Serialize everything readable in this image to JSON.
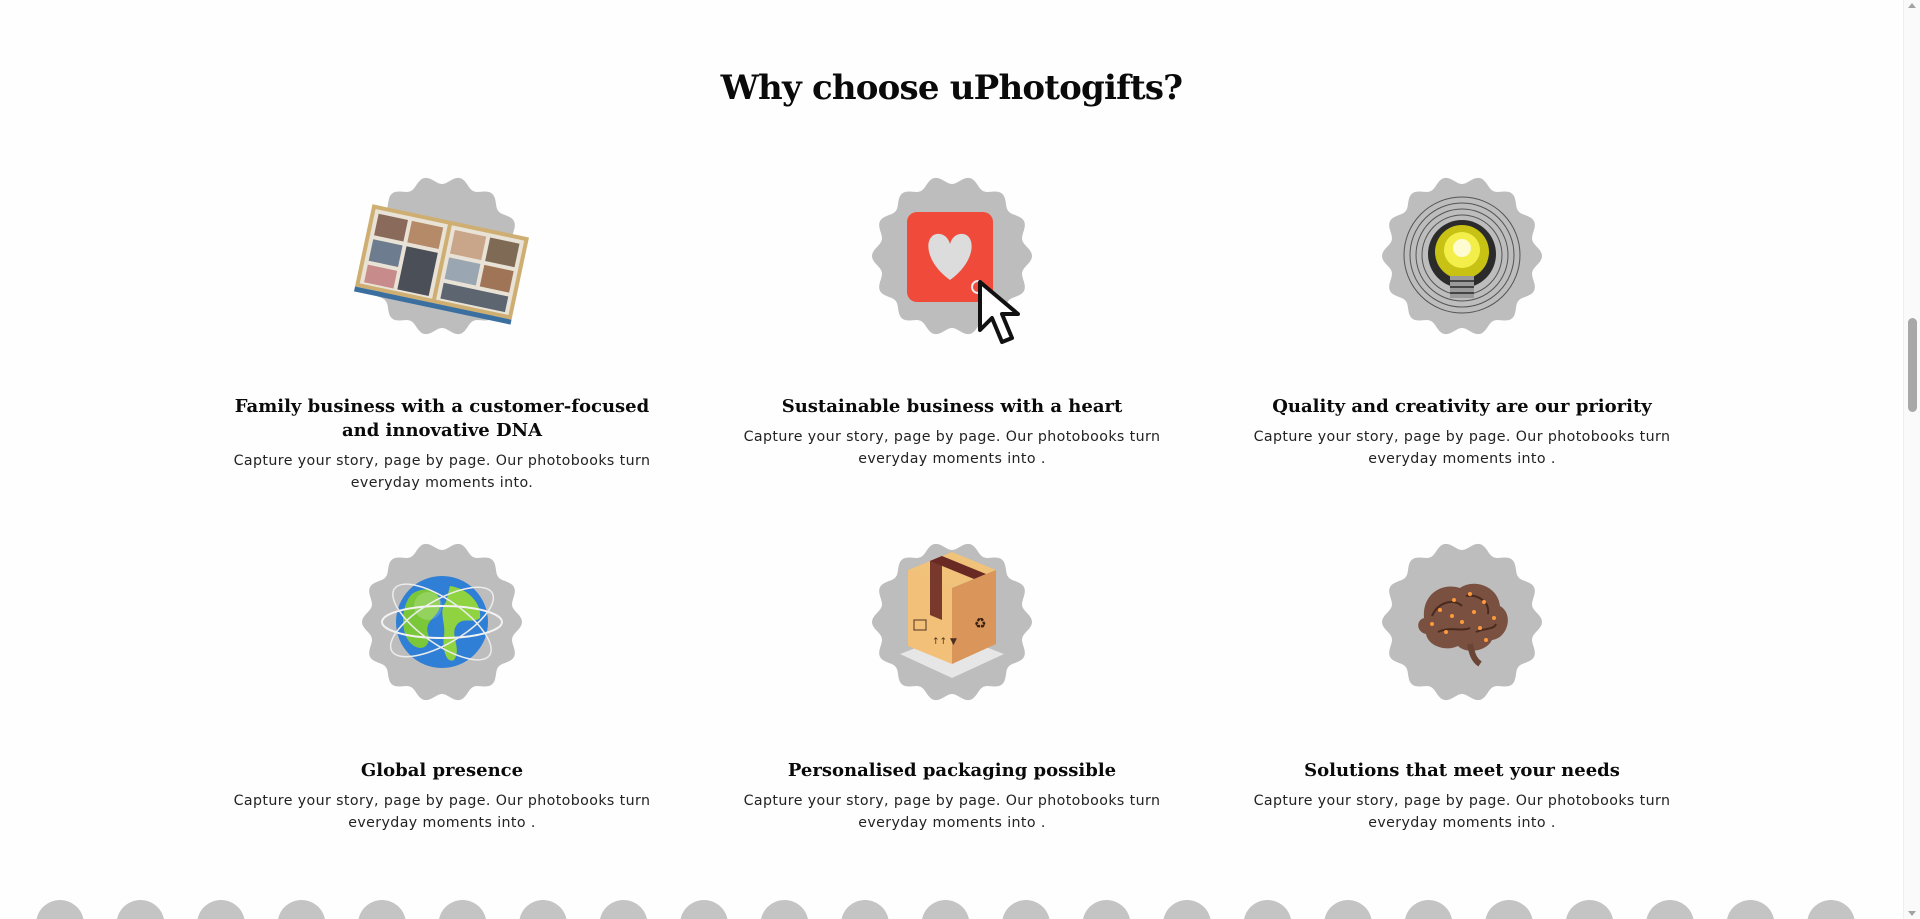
{
  "section": {
    "title": "Why choose uPhotogifts?"
  },
  "features": [
    {
      "title": "Family business with a customer-focused and innovative DNA",
      "text": "Capture your story, page by page. Our photobooks turn everyday moments into.",
      "icon": "photobook-icon"
    },
    {
      "title": "Sustainable business with a heart",
      "text": "Capture your story, page by page. Our photobooks turn everyday moments into .",
      "icon": "heart-click-icon"
    },
    {
      "title": "Quality and creativity are our priority",
      "text": "Capture your story, page by page. Our photobooks turn everyday moments into .",
      "icon": "lightbulb-icon"
    },
    {
      "title": "Global presence",
      "text": "Capture your story, page by page. Our photobooks turn everyday moments into .",
      "icon": "globe-icon"
    },
    {
      "title": "Personalised packaging possible",
      "text": "Capture your story, page by page. Our photobooks turn everyday moments into .",
      "icon": "package-box-icon"
    },
    {
      "title": "Solutions that meet your needs",
      "text": "Capture your story, page by page. Our photobooks turn everyday moments into .",
      "icon": "brain-icon"
    }
  ],
  "colors": {
    "badge": "#bdbdbd",
    "heart_tile": "#f04a3a",
    "title_text": "#0a0a0a"
  }
}
